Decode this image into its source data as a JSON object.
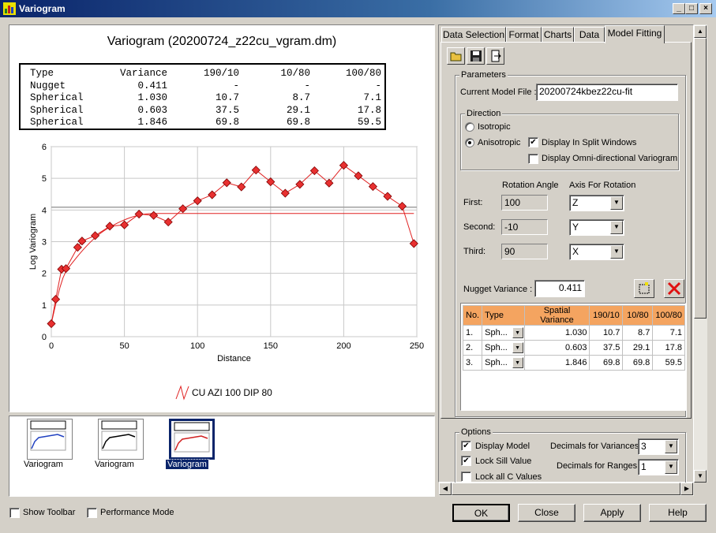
{
  "window": {
    "title": "Variogram"
  },
  "chart_header": {
    "title": "Variogram (20200724_z22cu_vgram.dm)",
    "table_columns": [
      "Type",
      "Variance",
      "190/10",
      "10/80",
      "100/80"
    ],
    "table_rows": [
      [
        "Nugget",
        "0.411",
        "-",
        "-",
        "-"
      ],
      [
        "Spherical",
        "1.030",
        "10.7",
        "8.7",
        "7.1"
      ],
      [
        "Spherical",
        "0.603",
        "37.5",
        "29.1",
        "17.8"
      ],
      [
        "Spherical",
        "1.846",
        "69.8",
        "69.8",
        "59.5"
      ]
    ]
  },
  "chart_data": {
    "type": "line",
    "xlabel": "Distance",
    "ylabel": "Log Variogram",
    "xlim": [
      0,
      250
    ],
    "ylim": [
      0,
      6
    ],
    "x_ticks": [
      "0",
      "50",
      "100",
      "150",
      "200",
      "250"
    ],
    "y_ticks": [
      "0",
      "1",
      "2",
      "3",
      "4",
      "5",
      "6"
    ],
    "grid": true,
    "legend": "bottom-center",
    "sill": 3.89,
    "sill_ref": 4.09,
    "series": [
      {
        "name": "CU AZI 100 DIP 80",
        "color": "#e02020",
        "x": [
          0,
          3,
          7,
          10,
          18,
          21,
          30,
          40,
          50,
          60,
          70,
          80,
          90,
          100,
          110,
          120,
          130,
          140,
          150,
          160,
          170,
          180,
          190,
          200,
          210,
          220,
          230,
          240,
          248
        ],
        "y": [
          0.41,
          1.18,
          2.13,
          2.15,
          2.82,
          3.02,
          3.19,
          3.49,
          3.53,
          3.87,
          3.83,
          3.62,
          4.04,
          4.29,
          4.48,
          4.86,
          4.73,
          5.26,
          4.89,
          4.53,
          4.81,
          5.24,
          4.85,
          5.41,
          5.08,
          4.74,
          4.43,
          4.12,
          2.94
        ]
      }
    ]
  },
  "thumbnails": [
    {
      "label": "Variogram",
      "selected": false
    },
    {
      "label": "Variogram",
      "selected": false
    },
    {
      "label": "Variogram",
      "selected": true
    }
  ],
  "bottom_bar": {
    "show_toolbar": "Show Toolbar",
    "performance_mode": "Performance Mode",
    "ok": "OK",
    "close": "Close",
    "apply": "Apply",
    "help": "Help"
  },
  "tabs": [
    "Data Selection",
    "Format",
    "Charts",
    "Data",
    "Model Fitting"
  ],
  "active_tab": "Model Fitting",
  "toolbar_icons": [
    "open-folder-icon",
    "save-icon",
    "export-icon"
  ],
  "parameters": {
    "group_label": "Parameters",
    "model_file_label": "Current Model File :",
    "model_file_value": "20200724kbez22cu-fit",
    "direction_label": "Direction",
    "isotropic_label": "Isotropic",
    "anisotropic_label": "Anisotropic",
    "anisotropic_selected": true,
    "split_windows_label": "Display In Split Windows",
    "split_windows_checked": true,
    "omni_label": "Display Omni-directional Variogram",
    "omni_checked": false,
    "rotation_angle_header": "Rotation Angle",
    "axis_header": "Axis For Rotation",
    "rotations": [
      {
        "label": "First:",
        "angle": "100",
        "axis": "Z"
      },
      {
        "label": "Second:",
        "angle": "-10",
        "axis": "Y"
      },
      {
        "label": "Third:",
        "angle": "90",
        "axis": "X"
      }
    ],
    "nugget_label": "Nugget Variance :",
    "nugget_value": "0.411"
  },
  "structures": {
    "columns": [
      "No.",
      "Type",
      "Spatial Variance",
      "190/10",
      "10/80",
      "100/80"
    ],
    "rows": [
      [
        "1.",
        "Sph...",
        "1.030",
        "10.7",
        "8.7",
        "7.1"
      ],
      [
        "2.",
        "Sph...",
        "0.603",
        "37.5",
        "29.1",
        "17.8"
      ],
      [
        "3.",
        "Sph...",
        "1.846",
        "69.8",
        "69.8",
        "59.5"
      ]
    ]
  },
  "options": {
    "group_label": "Options",
    "display_model": "Display Model",
    "display_model_checked": true,
    "lock_sill": "Lock Sill Value",
    "lock_sill_checked": true,
    "lock_all_c": "Lock all C Values",
    "lock_all_c_checked": false,
    "decimals_variances_label": "Decimals for Variances",
    "decimals_variances": "3",
    "decimals_ranges_label": "Decimals for Ranges",
    "decimals_ranges": "1"
  }
}
